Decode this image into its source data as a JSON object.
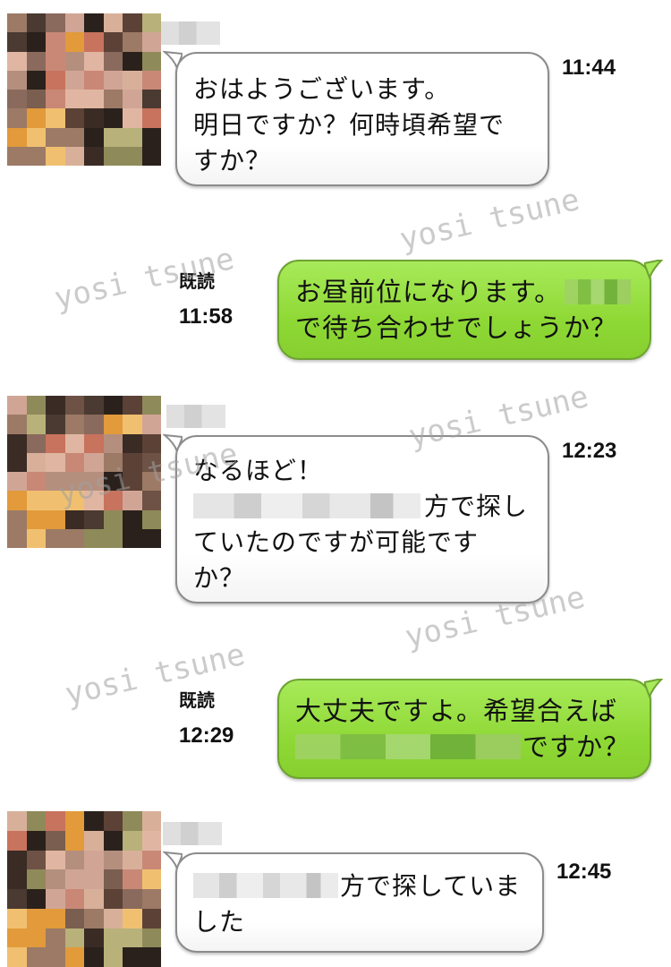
{
  "colors": {
    "incoming_bubble": "#ffffff",
    "outgoing_bubble": "#8fd936",
    "watermark": "#a0a0a0"
  },
  "messages": [
    {
      "direction": "incoming",
      "avatar": "blurred-avatar",
      "sender_name": "",
      "lines": [
        "おはようございます。",
        "明日ですか？何時頃希望で",
        "すか？"
      ],
      "time": "11:44"
    },
    {
      "direction": "outgoing",
      "read_label": "既読",
      "lines": [
        "お昼前位になります。",
        "で待ち合わせでしょうか？"
      ],
      "time": "11:58"
    },
    {
      "direction": "incoming",
      "avatar": "blurred-avatar",
      "sender_name": "",
      "lines": [
        "なるほど！",
        "方で探し",
        "ていたのですが可能です",
        "か？"
      ],
      "time": "12:23"
    },
    {
      "direction": "outgoing",
      "read_label": "既読",
      "lines": [
        "大丈夫ですよ。希望合えば",
        "ですか？"
      ],
      "time": "12:29"
    },
    {
      "direction": "incoming",
      "avatar": "blurred-avatar",
      "sender_name": "",
      "lines": [
        "方で探していま",
        "した"
      ],
      "time": "12:45"
    }
  ],
  "watermark": "yosi tsune"
}
